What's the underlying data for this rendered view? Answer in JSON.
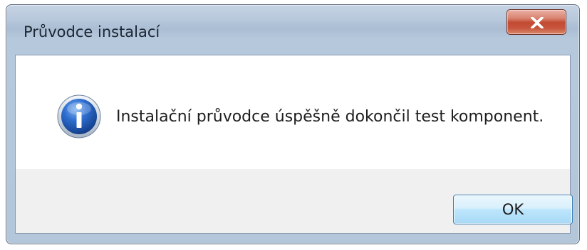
{
  "window": {
    "title": "Průvodce instalací"
  },
  "titlebar": {
    "close_icon": "close-icon",
    "close_color": "#c7553d"
  },
  "dialog": {
    "icon": "info-icon",
    "icon_color": "#1f5fb8",
    "message": "Instalační průvodce úspěšně dokončil test komponent."
  },
  "buttons": {
    "ok_label": "OK"
  }
}
